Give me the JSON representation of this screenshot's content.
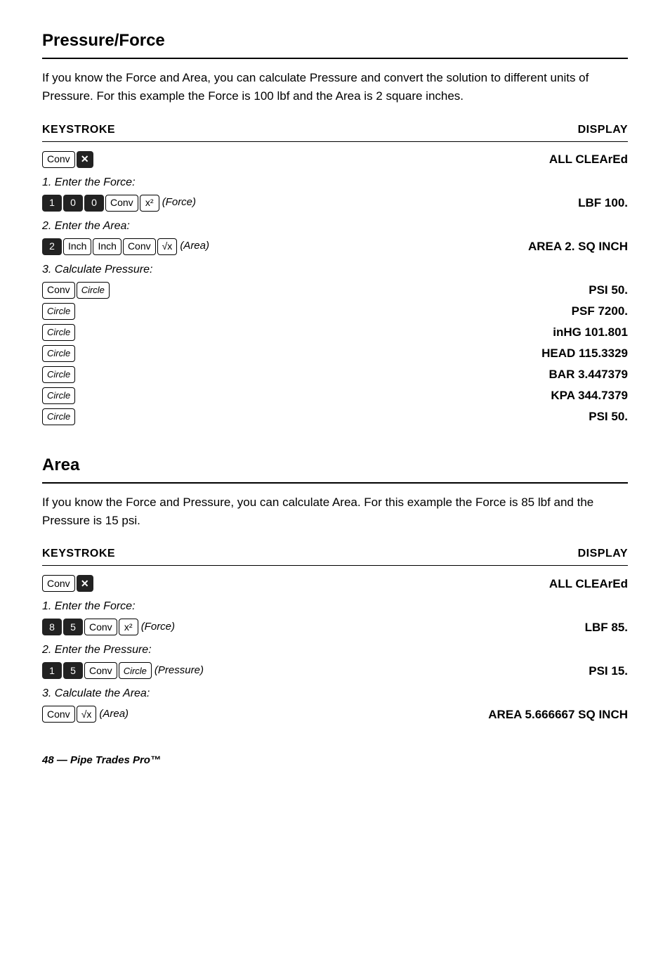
{
  "section1": {
    "title": "Pressure/Force",
    "description": "If you know the Force and Area, you can calculate Pressure and convert the solution to different units of Pressure. For this example the Force is 100 lbf and the Area is 2 square inches.",
    "keystroke_header": "KEYSTROKE",
    "display_header": "DISPLAY",
    "rows": [
      {
        "type": "clear",
        "keys": [
          "Conv",
          "X"
        ],
        "display": "ALL CLEArEd"
      },
      {
        "type": "step",
        "label": "1.  Enter the Force:",
        "keys": [
          "1",
          "0",
          "0",
          "Conv",
          "x²",
          "(Force)"
        ],
        "display": "LBF  100."
      },
      {
        "type": "step",
        "label": "2.  Enter the Area:",
        "keys": [
          "2",
          "Inch",
          "Inch",
          "Conv",
          "√x",
          "(Area)"
        ],
        "display": "AREA  2. SQ INCH"
      },
      {
        "type": "step",
        "label": "3.  Calculate Pressure:",
        "keys": [
          "Conv",
          "Circle"
        ],
        "display": "PSI 50."
      },
      {
        "type": "circle_row",
        "display": "PSF 7200."
      },
      {
        "type": "circle_row",
        "display": "inHG 101.801"
      },
      {
        "type": "circle_row",
        "display": "HEAD 115.3329"
      },
      {
        "type": "circle_row",
        "display": "BAR 3.447379"
      },
      {
        "type": "circle_row",
        "display": "KPA 344.7379"
      },
      {
        "type": "circle_row",
        "display": "PSI 50."
      }
    ]
  },
  "section2": {
    "title": "Area",
    "description": "If you know the Force and Pressure, you can calculate Area. For this example the Force is 85 lbf and the Pressure is 15 psi.",
    "keystroke_header": "KEYSTROKE",
    "display_header": "DISPLAY",
    "rows": [
      {
        "type": "clear",
        "keys": [
          "Conv",
          "X"
        ],
        "display": "ALL  CLEArEd"
      },
      {
        "type": "step",
        "label": "1.  Enter the Force:",
        "keys": [
          "8",
          "5",
          "Conv",
          "x²",
          "(Force)"
        ],
        "display": "LBF 85."
      },
      {
        "type": "step",
        "label": "2.  Enter the Pressure:",
        "keys": [
          "1",
          "5",
          "Conv",
          "Circle",
          "(Pressure)"
        ],
        "display": "PSI  15."
      },
      {
        "type": "step",
        "label": "3.  Calculate the Area:",
        "keys": [
          "Conv",
          "√x",
          "(Area)"
        ],
        "display": "AREA 5.666667 SQ INCH"
      }
    ]
  },
  "footer": {
    "text": "48 — Pipe Trades Pro™"
  }
}
